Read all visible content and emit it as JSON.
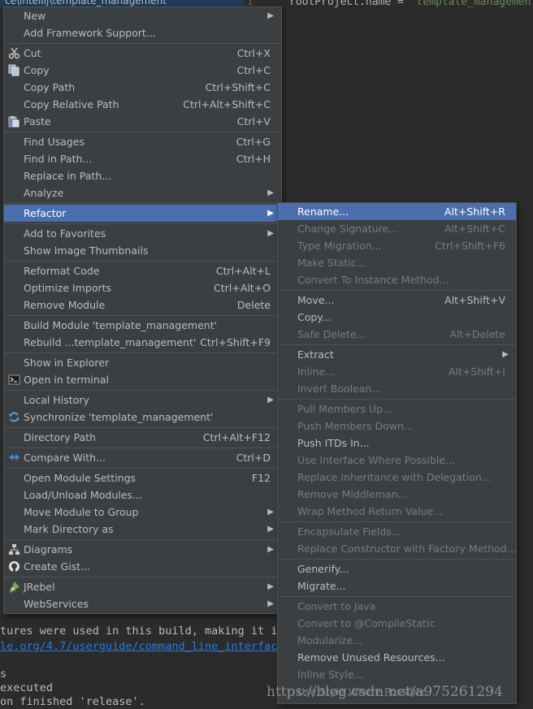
{
  "editor": {
    "line_number": "1",
    "code_prefix": "rootProject.name = ",
    "code_string": "'template_managemen",
    "tab_path": "ce\\intellij\\template_management"
  },
  "context_menu": {
    "items": [
      {
        "label": "New",
        "shortcut": "",
        "arrow": true
      },
      {
        "label": "Add Framework Support...",
        "shortcut": "",
        "arrow": false
      },
      {
        "label": "Cut",
        "shortcut": "Ctrl+X",
        "icon": "scissors-icon"
      },
      {
        "label": "Copy",
        "shortcut": "Ctrl+C",
        "icon": "copy-icon"
      },
      {
        "label": "Copy Path",
        "shortcut": "Ctrl+Shift+C"
      },
      {
        "label": "Copy Relative Path",
        "shortcut": "Ctrl+Alt+Shift+C"
      },
      {
        "label": "Paste",
        "shortcut": "Ctrl+V",
        "icon": "paste-icon"
      },
      {
        "label": "Find Usages",
        "shortcut": "Ctrl+G"
      },
      {
        "label": "Find in Path...",
        "shortcut": "Ctrl+H"
      },
      {
        "label": "Replace in Path...",
        "shortcut": ""
      },
      {
        "label": "Analyze",
        "shortcut": "",
        "arrow": true
      },
      {
        "label": "Refactor",
        "shortcut": "",
        "arrow": true,
        "selected": true
      },
      {
        "label": "Add to Favorites",
        "shortcut": "",
        "arrow": true
      },
      {
        "label": "Show Image Thumbnails",
        "shortcut": ""
      },
      {
        "label": "Reformat Code",
        "shortcut": "Ctrl+Alt+L"
      },
      {
        "label": "Optimize Imports",
        "shortcut": "Ctrl+Alt+O"
      },
      {
        "label": "Remove Module",
        "shortcut": "Delete"
      },
      {
        "label": "Build Module 'template_management'",
        "shortcut": ""
      },
      {
        "label": "Rebuild ...template_management'",
        "shortcut": "Ctrl+Shift+F9"
      },
      {
        "label": "Show in Explorer",
        "shortcut": ""
      },
      {
        "label": "Open in terminal",
        "shortcut": "",
        "icon": "terminal-icon"
      },
      {
        "label": "Local History",
        "shortcut": "",
        "arrow": true
      },
      {
        "label": "Synchronize 'template_management'",
        "shortcut": "",
        "icon": "sync-icon"
      },
      {
        "label": "Directory Path",
        "shortcut": "Ctrl+Alt+F12"
      },
      {
        "label": "Compare With...",
        "shortcut": "Ctrl+D",
        "icon": "compare-icon"
      },
      {
        "label": "Open Module Settings",
        "shortcut": "F12"
      },
      {
        "label": "Load/Unload Modules...",
        "shortcut": ""
      },
      {
        "label": "Move Module to Group",
        "shortcut": "",
        "arrow": true
      },
      {
        "label": "Mark Directory as",
        "shortcut": "",
        "arrow": true
      },
      {
        "label": "Diagrams",
        "shortcut": "",
        "arrow": true,
        "icon": "diagram-icon"
      },
      {
        "label": "Create Gist...",
        "shortcut": "",
        "icon": "github-icon"
      },
      {
        "label": "JRebel",
        "shortcut": "",
        "arrow": true,
        "icon": "jrebel-icon"
      },
      {
        "label": "WebServices",
        "shortcut": "",
        "arrow": true
      }
    ]
  },
  "refactor_menu": {
    "items": [
      {
        "label": "Rename...",
        "shortcut": "Alt+Shift+R",
        "selected": true
      },
      {
        "label": "Change Signature...",
        "shortcut": "Alt+Shift+C",
        "disabled": true
      },
      {
        "label": "Type Migration...",
        "shortcut": "Ctrl+Shift+F6",
        "disabled": true
      },
      {
        "label": "Make Static...",
        "shortcut": "",
        "disabled": true
      },
      {
        "label": "Convert To Instance Method...",
        "shortcut": "",
        "disabled": true
      },
      {
        "label": "Move...",
        "shortcut": "Alt+Shift+V"
      },
      {
        "label": "Copy...",
        "shortcut": ""
      },
      {
        "label": "Safe Delete...",
        "shortcut": "Alt+Delete",
        "disabled": true
      },
      {
        "label": "Extract",
        "shortcut": "",
        "arrow": true
      },
      {
        "label": "Inline...",
        "shortcut": "Alt+Shift+I",
        "disabled": true
      },
      {
        "label": "Invert Boolean...",
        "shortcut": "",
        "disabled": true
      },
      {
        "label": "Pull Members Up...",
        "shortcut": "",
        "disabled": true
      },
      {
        "label": "Push Members Down...",
        "shortcut": "",
        "disabled": true
      },
      {
        "label": "Push ITDs In...",
        "shortcut": ""
      },
      {
        "label": "Use Interface Where Possible...",
        "shortcut": "",
        "disabled": true
      },
      {
        "label": "Replace Inheritance with Delegation...",
        "shortcut": "",
        "disabled": true
      },
      {
        "label": "Remove Middleman...",
        "shortcut": "",
        "disabled": true
      },
      {
        "label": "Wrap Method Return Value...",
        "shortcut": "",
        "disabled": true
      },
      {
        "label": "Encapsulate Fields...",
        "shortcut": "",
        "disabled": true
      },
      {
        "label": "Replace Constructor with Factory Method...",
        "shortcut": "",
        "disabled": true
      },
      {
        "label": "Generify...",
        "shortcut": ""
      },
      {
        "label": "Migrate...",
        "shortcut": ""
      },
      {
        "label": "Convert to Java",
        "shortcut": "",
        "disabled": true
      },
      {
        "label": "Convert to @CompileStatic",
        "shortcut": "",
        "disabled": true
      },
      {
        "label": "Modularize...",
        "shortcut": "",
        "disabled": true
      },
      {
        "label": "Remove Unused Resources...",
        "shortcut": ""
      },
      {
        "label": "Inline Style...",
        "shortcut": "",
        "disabled": true
      },
      {
        "label": "Use Style Where Possible...",
        "shortcut": "",
        "disabled": true
      }
    ]
  },
  "console": {
    "line1": "tures were used in this build, making it in",
    "line2": "le.org/4.7/userguide/command_line_interface",
    "line3": "s",
    "line4": " executed",
    "line5": "on finished 'release'."
  },
  "watermark": "https://blog.csdn.net/a975261294"
}
